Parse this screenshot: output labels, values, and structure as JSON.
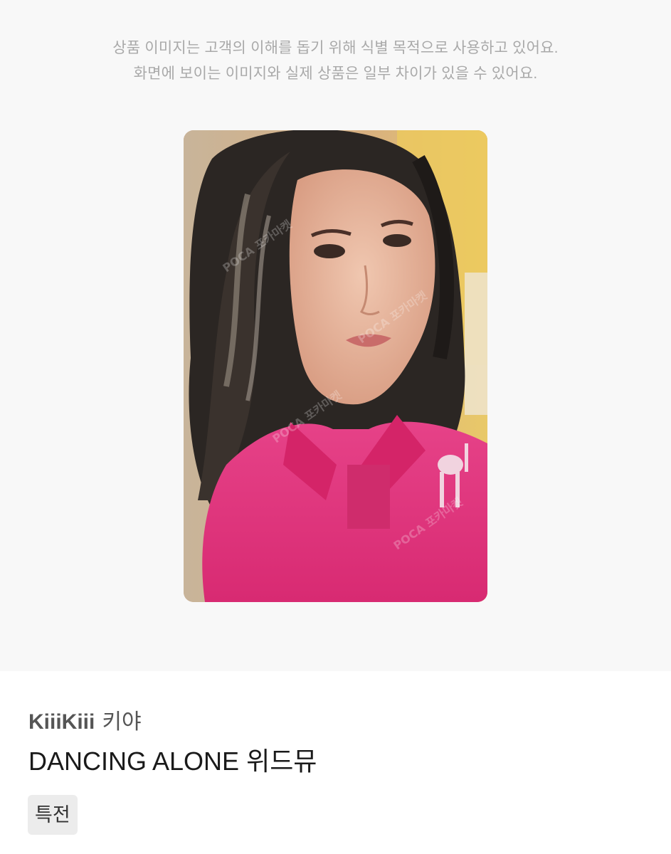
{
  "notice": {
    "line1": "상품 이미지는 고객의 이해를 돕기 위해 식별 목적으로 사용하고 있어요.",
    "line2": "화면에 보이는 이미지와 실제 상품은 일부 차이가 있을 수 있어요."
  },
  "product": {
    "group": "KiiiKiii",
    "member": "키야",
    "title": "DANCING ALONE 위드뮤",
    "tag": "특전",
    "watermark": "POCA 포카마켓"
  },
  "colors": {
    "shirt": "#e0307a",
    "hair": "#2a2522",
    "skin": "#e3b39a",
    "wall": "#e9c968"
  }
}
